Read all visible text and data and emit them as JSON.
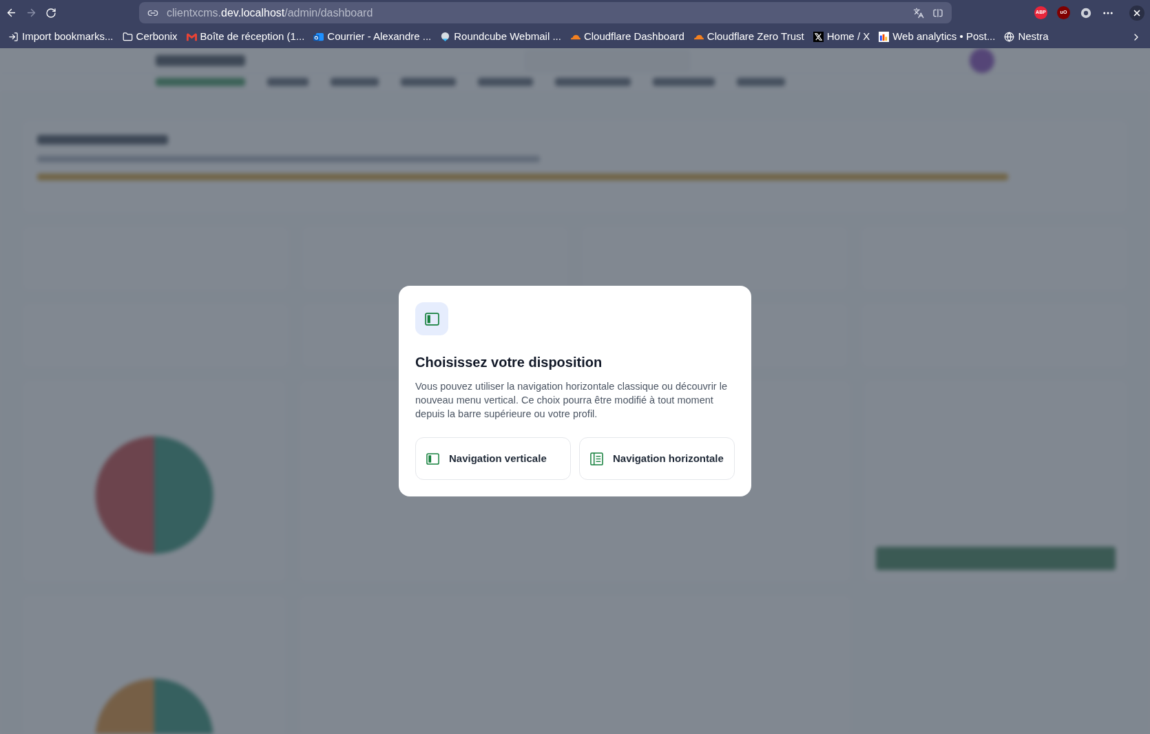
{
  "browser": {
    "url": {
      "host_prefix": "clientxcms.",
      "host_main": "dev.localhost",
      "path": "/admin/dashboard"
    },
    "extensions": [
      {
        "label": "ABP",
        "color": "#e8263b"
      },
      {
        "label": "uO",
        "color": "#800000"
      }
    ],
    "bookmarks": [
      {
        "label": "Import bookmarks...",
        "kind": "import"
      },
      {
        "label": "Cerbonix",
        "kind": "folder"
      },
      {
        "label": "Boîte de réception (1...",
        "kind": "gmail"
      },
      {
        "label": "Courrier - Alexandre ...",
        "kind": "outlook"
      },
      {
        "label": "Roundcube Webmail ...",
        "kind": "roundcube"
      },
      {
        "label": "Cloudflare Dashboard",
        "kind": "cloudflare"
      },
      {
        "label": "Cloudflare Zero Trust",
        "kind": "cloudflare"
      },
      {
        "label": "Home / X",
        "kind": "x"
      },
      {
        "label": "Web analytics • Post...",
        "kind": "analytics"
      },
      {
        "label": "Nestra",
        "kind": "globe"
      }
    ]
  },
  "dialog": {
    "title": "Choisissez votre disposition",
    "body": "Vous pouvez utiliser la navigation horizontale classique ou découvrir le nouveau menu vertical. Ce choix pourra être modifié à tout moment depuis la barre supérieure ou votre profil.",
    "options": [
      {
        "label": "Navigation verticale",
        "kind": "vertical"
      },
      {
        "label": "Navigation horizontale",
        "kind": "horizontal"
      }
    ]
  }
}
